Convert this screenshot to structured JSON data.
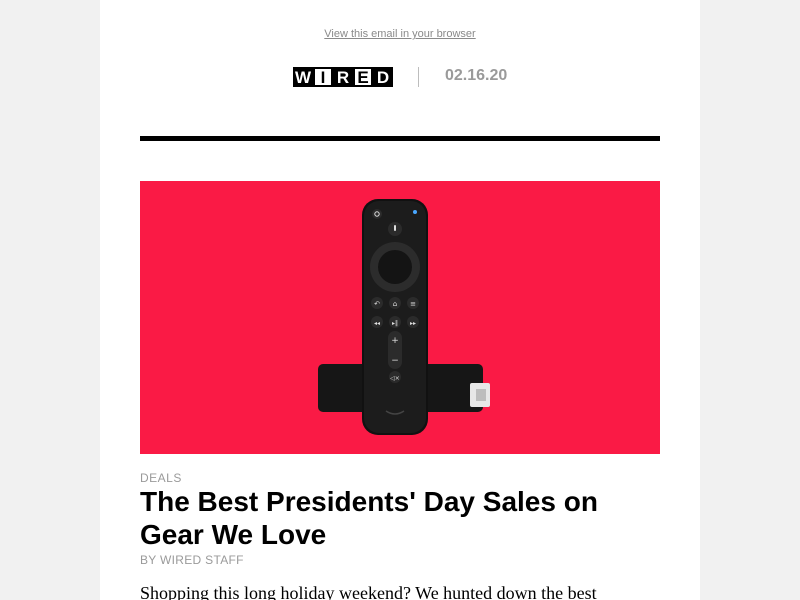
{
  "email": {
    "view_in_browser": "View this email in your browser",
    "logo_letters": [
      "W",
      "I",
      "R",
      "E",
      "D"
    ],
    "date": "02.16.20"
  },
  "article": {
    "kicker": "DEALS",
    "headline": "The Best Presidents' Day Sales on Gear We Love",
    "byline": "BY WIRED STAFF",
    "body": "Shopping this long holiday weekend? We hunted down the best"
  },
  "hero_image": {
    "background_color": "#fa1a45",
    "subject": "streaming-stick-remote"
  },
  "colors": {
    "page_bg": "#f1f1f1",
    "card_bg": "#ffffff",
    "muted_text": "#9a9a9a",
    "rule": "#000000"
  }
}
